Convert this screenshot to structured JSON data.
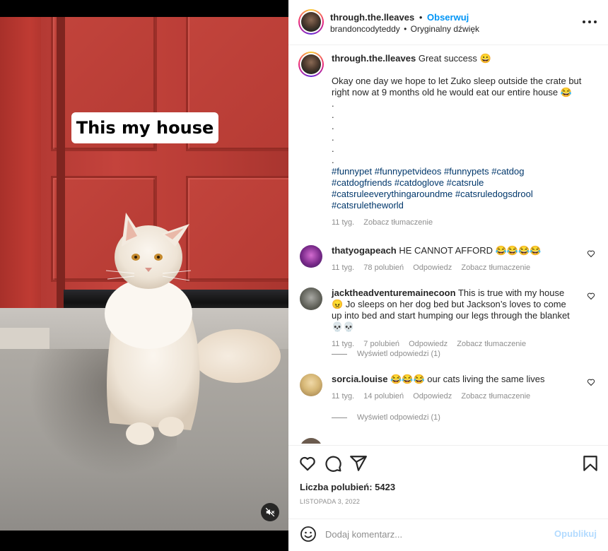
{
  "media": {
    "caption_text": "This my house",
    "mute_icon": "speaker-muted-icon"
  },
  "header": {
    "username": "through.the.lleaves",
    "separator": "•",
    "follow_label": "Obserwuj",
    "audio_user": "brandoncodyteddy",
    "audio_separator": "•",
    "audio_label": "Oryginalny dźwięk",
    "more_icon": "more-options-icon"
  },
  "post": {
    "username": "through.the.lleaves",
    "title": "Great success 😀",
    "body": "Okay one day we hope to let Zuko sleep outside the crate but right now at 9 months old he would eat our entire house 😂",
    "dots": ".\n.\n.\n.\n.\n.",
    "hashtags": "#funnypet #funnypetvideos #funnypets #catdog #catdogfriends #catdoglove #catsrule #catsruleeverythingaroundme #catsruledogsdrool #catsruletheworld",
    "age": "11 tyg.",
    "translate": "Zobacz tłumaczenie"
  },
  "comments": [
    {
      "username": "thatyogapeach",
      "text": "HE CANNOT AFFORD 😂😂😂😂",
      "age": "11 tyg.",
      "likes": "78 polubień",
      "reply": "Odpowiedz",
      "translate": "Zobacz tłumaczenie"
    },
    {
      "username": "jacktheadventuremainecoon",
      "text": "This is true with my house 😠 Jo sleeps on her dog bed but Jackson’s loves to come up into bed and start humping our legs through the blanket 💀💀",
      "age": "11 tyg.",
      "likes": "7 polubień",
      "reply": "Odpowiedz",
      "translate": "Zobacz tłumaczenie",
      "view_replies": "Wyświetl odpowiedzi (1)"
    },
    {
      "username": "sorcia.louise",
      "text": "😂😂😂 our cats living the same lives",
      "age": "11 tyg.",
      "likes": "14 polubień",
      "reply": "Odpowiedz",
      "translate": "Zobacz tłumaczenie",
      "view_replies": "Wyświetl odpowiedzi (1)"
    }
  ],
  "actions": {
    "like_icon": "heart-icon",
    "comment_icon": "comment-icon",
    "share_icon": "share-icon",
    "save_icon": "bookmark-icon",
    "likes_count": "Liczba polubień: 5423",
    "date": "LISTOPADA 3, 2022"
  },
  "add_comment": {
    "emoji_icon": "emoji-icon",
    "placeholder": "Dodaj komentarz...",
    "publish_label": "Opublikuj"
  },
  "colors": {
    "link_blue": "#0095f6",
    "hashtag_blue": "#00376b",
    "muted_gray": "#8e8e8e",
    "publish_disabled": "#b3dbff"
  }
}
